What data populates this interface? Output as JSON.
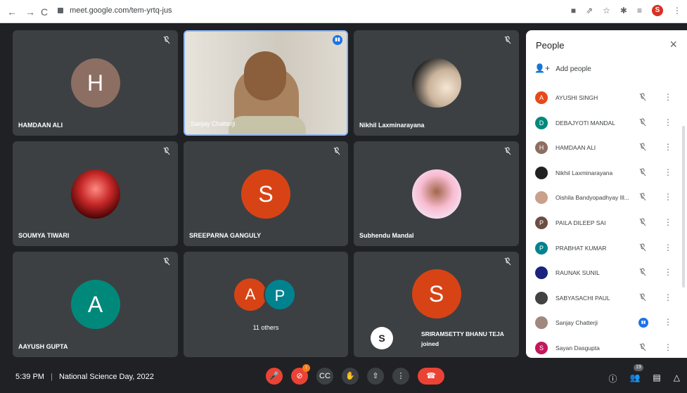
{
  "browser": {
    "url": "meet.google.com/tem-yrtq-jus",
    "profile_initial": "S"
  },
  "tiles": [
    {
      "name": "HAMDAAN ALI",
      "initial": "H",
      "color": "#8d6e63"
    },
    {
      "name": "Sanjay Chatterji",
      "initial": "",
      "color": ""
    },
    {
      "name": "Nikhil Laxminarayana",
      "initial": "",
      "color": ""
    },
    {
      "name": "SOUMYA TIWARI",
      "initial": "",
      "color": ""
    },
    {
      "name": "SREEPARNA GANGULY",
      "initial": "S",
      "color": "#d84315"
    },
    {
      "name": "Subhendu Mandal",
      "initial": "",
      "color": ""
    },
    {
      "name": "AAYUSH GUPTA",
      "initial": "A",
      "color": "#00897b"
    },
    {
      "name": "11 others",
      "initial_a": "A",
      "initial_p": "P"
    },
    {
      "name": "",
      "initial": "S",
      "color": "#d84315"
    }
  ],
  "toast": {
    "initial": "S",
    "text": "SRIRAMSETTY BHANU TEJA joined"
  },
  "people": {
    "title": "People",
    "add_label": "Add people",
    "list": [
      {
        "name": "AYUSHI SINGH",
        "initial": "A",
        "color": "#e64a19"
      },
      {
        "name": "DEBAJYOTI MANDAL",
        "initial": "D",
        "color": "#00897b"
      },
      {
        "name": "HAMDAAN ALI",
        "initial": "H",
        "color": "#8d6e63"
      },
      {
        "name": "Nikhil Laxminarayana",
        "initial": "",
        "color": "#212121"
      },
      {
        "name": "Oishila Bandyopadhyay Ill...",
        "initial": "",
        "color": "#c9a08b"
      },
      {
        "name": "PAILA DILEEP SAI",
        "initial": "P",
        "color": "#6d4c41"
      },
      {
        "name": "PRABHAT KUMAR",
        "initial": "P",
        "color": "#00838f"
      },
      {
        "name": "RAUNAK SUNIL",
        "initial": "",
        "color": "#1a237e"
      },
      {
        "name": "SABYASACHI PAUL",
        "initial": "",
        "color": "#424242"
      },
      {
        "name": "Sanjay Chatterji",
        "initial": "",
        "color": "#a1887f"
      },
      {
        "name": "Sayan Dasgupta",
        "initial": "S",
        "color": "#c2185b"
      }
    ]
  },
  "bottom": {
    "time": "5:39 PM",
    "separator": "|",
    "meeting": "National Science Day, 2022",
    "badge": "!",
    "participant_count": "19"
  }
}
